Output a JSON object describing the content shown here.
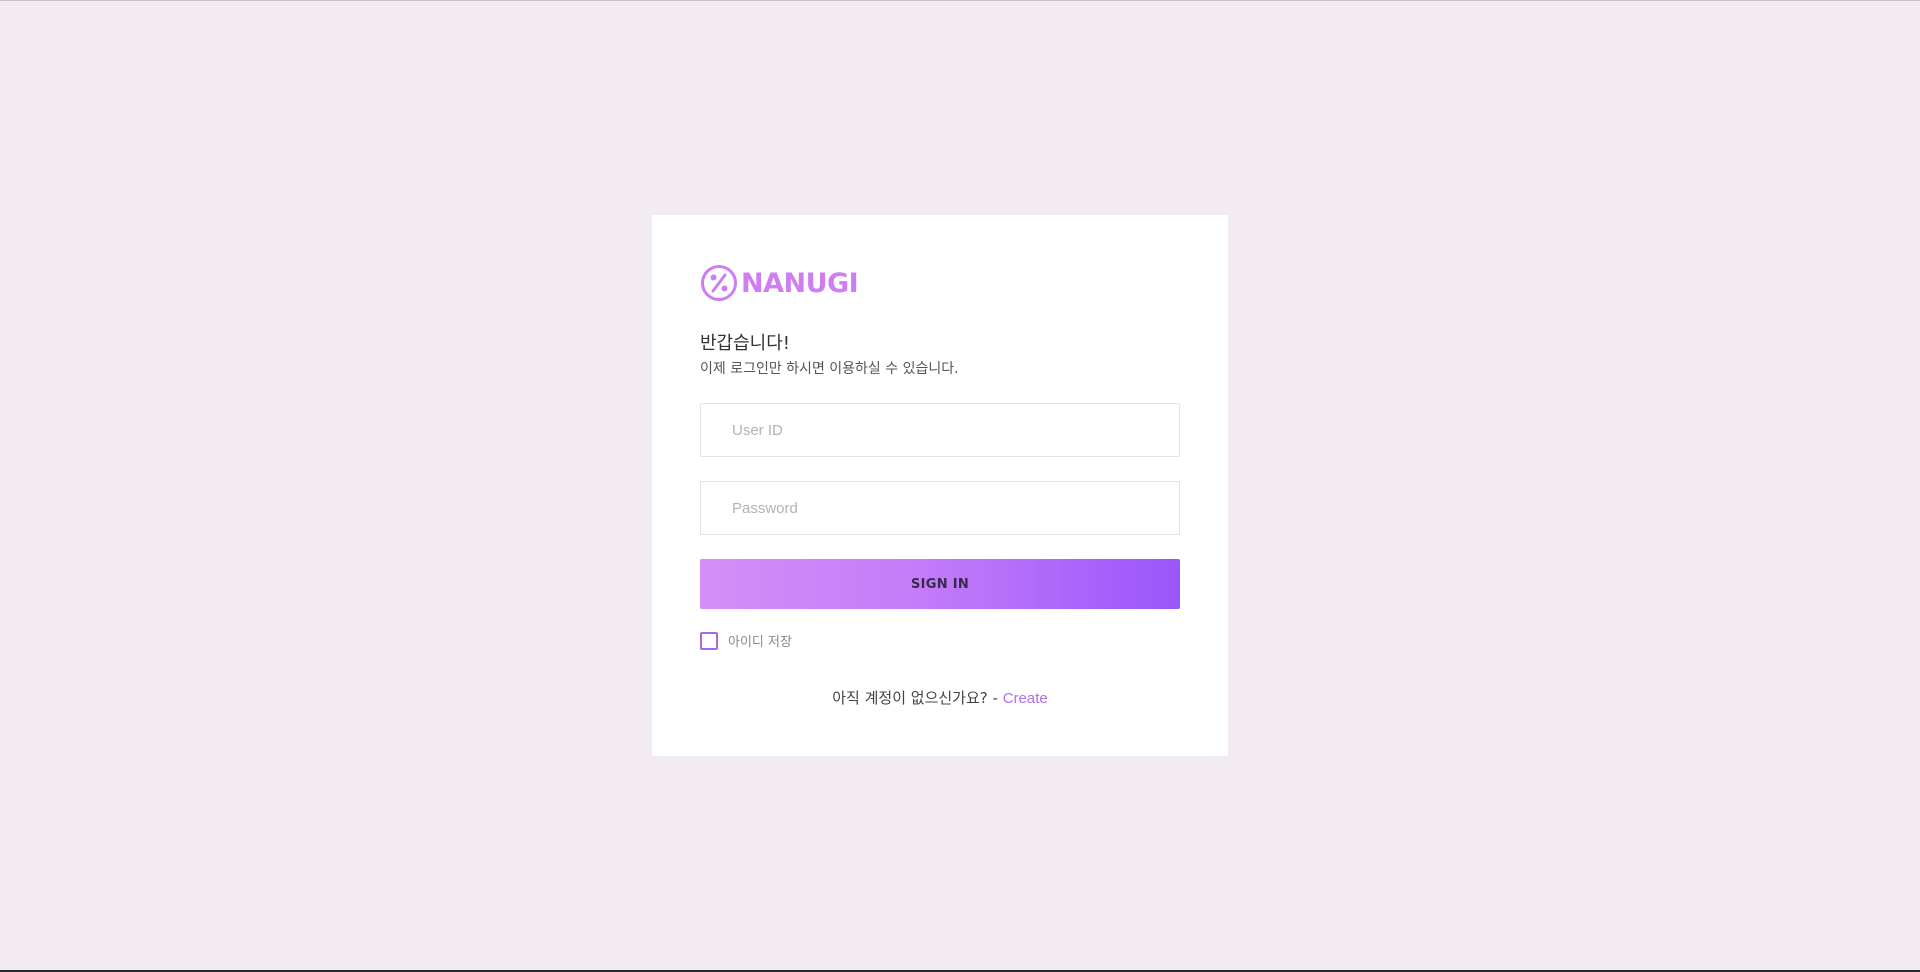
{
  "theme": {
    "background": "#f2ecf2",
    "card_background": "#ffffff",
    "accent": "#cf7df2",
    "button_gradient_start": "#d68ef8",
    "button_gradient_end": "#9a56fb",
    "link": "#b06ee8"
  },
  "logo": {
    "icon": "percent-circle-icon",
    "text": "NANUGI"
  },
  "login": {
    "greeting": "반갑습니다!",
    "subtitle": "이제 로그인만 하시면 이용하실 수 있습니다.",
    "user_id": {
      "value": "",
      "placeholder": "User ID"
    },
    "password": {
      "value": "",
      "placeholder": "Password"
    },
    "sign_in_label": "SIGN IN",
    "remember": {
      "checked": false,
      "label": "아이디 저장"
    },
    "signup": {
      "prompt": "아직 계정이 없으신가요?",
      "separator": " - ",
      "link_label": "Create"
    }
  }
}
